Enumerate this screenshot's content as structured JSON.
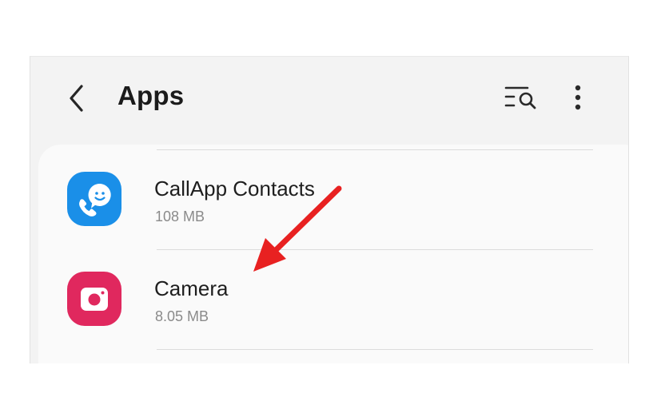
{
  "header": {
    "title": "Apps",
    "back_icon": "chevron-left-icon",
    "search_icon": "filter-search-icon",
    "more_icon": "more-vertical-icon"
  },
  "apps": [
    {
      "name": "CallApp Contacts",
      "size": "108 MB",
      "icon": "callapp-icon",
      "icon_color": "#1a8fe8"
    },
    {
      "name": "Camera",
      "size": "8.05 MB",
      "icon": "camera-icon",
      "icon_color": "#e0285e"
    }
  ],
  "annotation": {
    "arrow_color": "#e82121",
    "points_to": "Camera"
  }
}
